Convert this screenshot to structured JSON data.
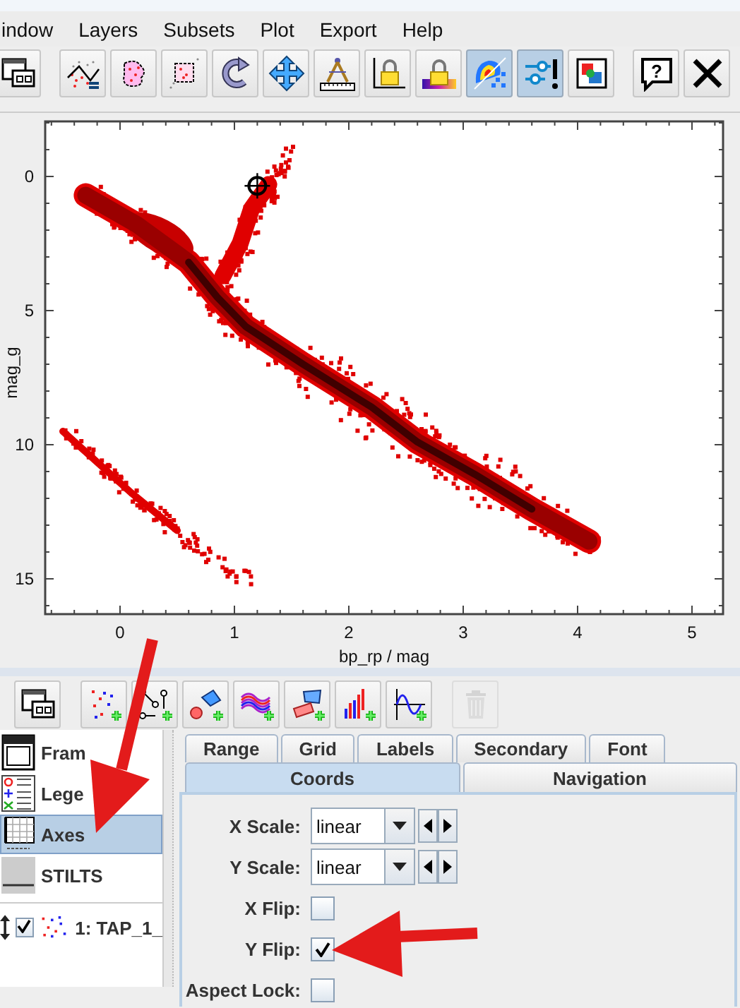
{
  "menu": [
    {
      "label": "indow"
    },
    {
      "label": "Layers"
    },
    {
      "label": "Subsets"
    },
    {
      "label": "Plot"
    },
    {
      "label": "Export"
    },
    {
      "label": "Help"
    }
  ],
  "toolbar": [
    {
      "selected": false
    },
    {
      "selected": false
    },
    {
      "selected": false
    },
    {
      "selected": false
    },
    {
      "selected": false
    },
    {
      "selected": false
    },
    {
      "selected": false
    },
    {
      "selected": false
    },
    {
      "selected": false
    },
    {
      "selected": true
    },
    {
      "selected": true
    },
    {
      "selected": false
    },
    {
      "selected": false
    },
    {
      "selected": false
    }
  ],
  "help_glyph": "?",
  "plot": {
    "xlabel": "bp_rp / mag",
    "ylabel": "mag_g",
    "x_ticks": [
      "0",
      "1",
      "2",
      "3",
      "4",
      "5"
    ],
    "y_ticks": [
      "0",
      "5",
      "10",
      "15"
    ]
  },
  "layer_toolbar": [
    {
      "disabled": false
    },
    {
      "disabled": false
    },
    {
      "disabled": false
    },
    {
      "disabled": false
    },
    {
      "disabled": false
    },
    {
      "disabled": false
    },
    {
      "disabled": false
    },
    {
      "disabled": false
    },
    {
      "disabled": true
    }
  ],
  "control_list": [
    {
      "label": "Fram",
      "selected": false
    },
    {
      "label": "Lege",
      "selected": false
    },
    {
      "label": "Axes",
      "selected": true
    },
    {
      "label": "STILTS",
      "selected": false
    }
  ],
  "layers": [
    {
      "label": "1: TAP_1_",
      "checked": true
    }
  ],
  "tabs_row_1": [
    {
      "label": "Range",
      "selected": false
    },
    {
      "label": "Grid",
      "selected": false
    },
    {
      "label": "Labels",
      "selected": false
    },
    {
      "label": "Secondary",
      "selected": false
    },
    {
      "label": "Font",
      "selected": false
    }
  ],
  "tabs_row_2": [
    {
      "label": "Coords",
      "selected": true
    },
    {
      "label": "Navigation",
      "selected": false
    }
  ],
  "form": [
    {
      "kind": "combo",
      "label": "X Scale:",
      "value": "linear"
    },
    {
      "kind": "combo",
      "label": "Y Scale:",
      "value": "linear"
    },
    {
      "kind": "checkbox",
      "label": "X Flip:",
      "checked": false
    },
    {
      "kind": "checkbox",
      "label": "Y Flip:",
      "checked": true
    },
    {
      "kind": "checkbox",
      "label": "Aspect Lock:",
      "checked": false
    }
  ]
}
